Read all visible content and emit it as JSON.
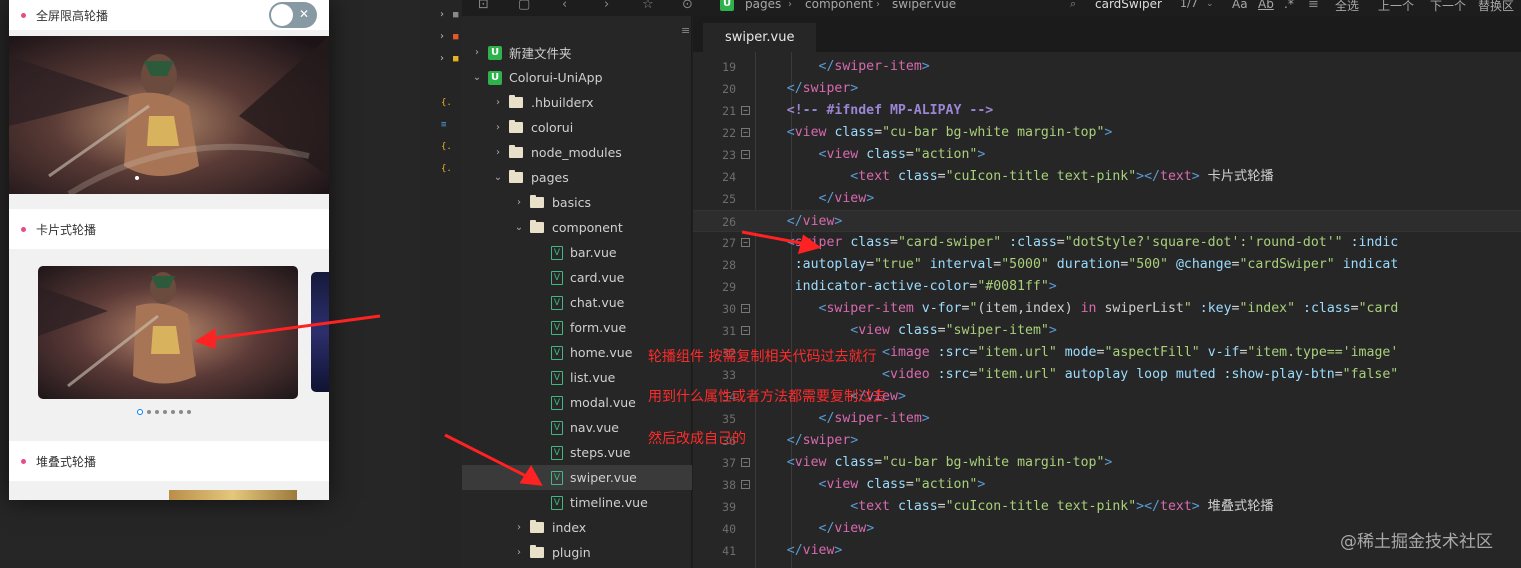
{
  "phone": {
    "section1_title": "全屏限高轮播",
    "section2_title": "卡片式轮播",
    "section3_title": "堆叠式轮播",
    "toggle_mark": "✕",
    "dots": [
      true,
      false,
      false,
      false,
      false,
      false,
      false
    ]
  },
  "toolbar": {
    "breadcrumb": [
      "pages",
      "component",
      "swiper.vue"
    ],
    "search_value": "cardSwiper",
    "match_count": "1/7",
    "select_all": "全选",
    "prev": "上一个",
    "next": "下一个",
    "replace": "替换区"
  },
  "explorer": {
    "items": [
      {
        "label": "新建文件夹",
        "type": "project",
        "level": 0,
        "chev": "›"
      },
      {
        "label": "Colorui-UniApp",
        "type": "project",
        "level": 0,
        "chev": "⌄"
      },
      {
        "label": ".hbuilderx",
        "type": "folder",
        "level": 1,
        "chev": "›"
      },
      {
        "label": "colorui",
        "type": "folder",
        "level": 1,
        "chev": "›"
      },
      {
        "label": "node_modules",
        "type": "folder",
        "level": 1,
        "chev": "›"
      },
      {
        "label": "pages",
        "type": "folder",
        "level": 1,
        "chev": "⌄"
      },
      {
        "label": "basics",
        "type": "folder",
        "level": 2,
        "chev": "›"
      },
      {
        "label": "component",
        "type": "folder",
        "level": 2,
        "chev": "⌄"
      },
      {
        "label": "bar.vue",
        "type": "vue",
        "level": 3,
        "chev": ""
      },
      {
        "label": "card.vue",
        "type": "vue",
        "level": 3,
        "chev": ""
      },
      {
        "label": "chat.vue",
        "type": "vue",
        "level": 3,
        "chev": ""
      },
      {
        "label": "form.vue",
        "type": "vue",
        "level": 3,
        "chev": ""
      },
      {
        "label": "home.vue",
        "type": "vue",
        "level": 3,
        "chev": ""
      },
      {
        "label": "list.vue",
        "type": "vue",
        "level": 3,
        "chev": ""
      },
      {
        "label": "modal.vue",
        "type": "vue",
        "level": 3,
        "chev": ""
      },
      {
        "label": "nav.vue",
        "type": "vue",
        "level": 3,
        "chev": ""
      },
      {
        "label": "steps.vue",
        "type": "vue",
        "level": 3,
        "chev": ""
      },
      {
        "label": "swiper.vue",
        "type": "vue",
        "level": 3,
        "chev": "",
        "selected": true
      },
      {
        "label": "timeline.vue",
        "type": "vue",
        "level": 3,
        "chev": ""
      },
      {
        "label": "index",
        "type": "folder",
        "level": 2,
        "chev": "›"
      },
      {
        "label": "plugin",
        "type": "folder",
        "level": 2,
        "chev": "›"
      }
    ]
  },
  "tab": {
    "label": "swiper.vue"
  },
  "editor": {
    "lines": [
      {
        "n": "19",
        "fold": false,
        "html": "        <span class='t'>&lt;/</span><span class='tg'>swiper-item</span><span class='t'>&gt;</span>"
      },
      {
        "n": "20",
        "fold": false,
        "html": "    <span class='t'>&lt;/</span><span class='tg'>swiper</span><span class='t'>&gt;</span>"
      },
      {
        "n": "21",
        "fold": true,
        "html": "    <span class='cm'>&lt;!-- #ifndef MP-ALIPAY --&gt;</span>"
      },
      {
        "n": "22",
        "fold": true,
        "html": "    <span class='t'>&lt;</span><span class='tg'>view</span> <span class='at'>class</span>=<span class='str'>\"cu-bar bg-white margin-top\"</span><span class='t'>&gt;</span>"
      },
      {
        "n": "23",
        "fold": true,
        "html": "        <span class='t'>&lt;</span><span class='tg'>view</span> <span class='at'>class</span>=<span class='str'>\"action\"</span><span class='t'>&gt;</span>"
      },
      {
        "n": "24",
        "fold": false,
        "html": "            <span class='t'>&lt;</span><span class='tg'>text</span> <span class='at'>class</span>=<span class='str'>\"cuIcon-title text-pink\"</span><span class='t'>&gt;&lt;/</span><span class='tg'>text</span><span class='t'>&gt;</span><span class='tx'> 卡片式轮播</span>"
      },
      {
        "n": "25",
        "fold": false,
        "html": "        <span class='t'>&lt;/</span><span class='tg'>view</span><span class='t'>&gt;</span>"
      },
      {
        "n": "26",
        "fold": false,
        "html": "    <span class='t'>&lt;/</span><span class='tg'>view</span><span class='t'>&gt;</span>"
      },
      {
        "n": "27",
        "fold": true,
        "html": "    <span class='t'>&lt;</span><span class='tg'>swiper</span> <span class='at'>class</span>=<span class='str'>\"card-swiper\"</span> <span class='at'>:class</span>=<span class='str'>\"dotStyle?'square-dot':'round-dot'\"</span> <span class='at'>:indic</span>"
      },
      {
        "n": "28",
        "fold": false,
        "html": "     <span class='at'>:autoplay</span>=<span class='str'>\"true\"</span> <span class='at'>interval</span>=<span class='str'>\"5000\"</span> <span class='at'>duration</span>=<span class='str'>\"500\"</span> <span class='at'>@change</span>=<span class='str'>\"cardSwiper\"</span> <span class='at'>indicat</span>"
      },
      {
        "n": "29",
        "fold": false,
        "html": "     <span class='at'>indicator-active-color</span>=<span class='str'>\"#0081ff\"</span><span class='t'>&gt;</span>"
      },
      {
        "n": "30",
        "fold": true,
        "html": "        <span class='t'>&lt;</span><span class='tg'>swiper-item</span> <span class='at'>v-for</span>=<span class='str'>\"</span><span class='tx'>(item,index) </span><span class='kw'>in</span><span class='tx'> swiperList</span><span class='str'>\"</span> <span class='at'>:key</span>=<span class='str'>\"index\"</span> <span class='at'>:class</span>=<span class='str'>\"card</span>"
      },
      {
        "n": "31",
        "fold": true,
        "html": "            <span class='t'>&lt;</span><span class='tg'>view</span> <span class='at'>class</span>=<span class='str'>\"swiper-item\"</span><span class='t'>&gt;</span>"
      },
      {
        "n": "32",
        "fold": false,
        "html": "                <span class='t'>&lt;</span><span class='tg'>image</span> <span class='at'>:src</span>=<span class='str'>\"item.url\"</span> <span class='at'>mode</span>=<span class='str'>\"aspectFill\"</span> <span class='at'>v-if</span>=<span class='str'>\"item.type=='image'</span>"
      },
      {
        "n": "33",
        "fold": false,
        "html": "                <span class='t'>&lt;</span><span class='tg'>video</span> <span class='at'>:src</span>=<span class='str'>\"item.url\"</span> <span class='at'>autoplay loop muted</span> <span class='at'>:show-play-btn</span>=<span class='str'>\"false\"</span>"
      },
      {
        "n": "34",
        "fold": false,
        "html": "            <span class='t'>&lt;/</span><span class='tg'>view</span><span class='t'>&gt;</span>"
      },
      {
        "n": "35",
        "fold": false,
        "html": "        <span class='t'>&lt;/</span><span class='tg'>swiper-item</span><span class='t'>&gt;</span>"
      },
      {
        "n": "36",
        "fold": false,
        "html": "    <span class='t'>&lt;/</span><span class='tg'>swiper</span><span class='t'>&gt;</span>"
      },
      {
        "n": "37",
        "fold": true,
        "html": "    <span class='t'>&lt;</span><span class='tg'>view</span> <span class='at'>class</span>=<span class='str'>\"cu-bar bg-white margin-top\"</span><span class='t'>&gt;</span>"
      },
      {
        "n": "38",
        "fold": true,
        "html": "        <span class='t'>&lt;</span><span class='tg'>view</span> <span class='at'>class</span>=<span class='str'>\"action\"</span><span class='t'>&gt;</span>"
      },
      {
        "n": "39",
        "fold": false,
        "html": "            <span class='t'>&lt;</span><span class='tg'>text</span> <span class='at'>class</span>=<span class='str'>\"cuIcon-title text-pink\"</span><span class='t'>&gt;&lt;/</span><span class='tg'>text</span><span class='t'>&gt;</span><span class='tx'> 堆叠式轮播</span>"
      },
      {
        "n": "40",
        "fold": false,
        "html": "        <span class='t'>&lt;/</span><span class='tg'>view</span><span class='t'>&gt;</span>"
      },
      {
        "n": "41",
        "fold": false,
        "html": "    <span class='t'>&lt;/</span><span class='tg'>view</span><span class='t'>&gt;</span>"
      }
    ]
  },
  "annotations": {
    "line1": "轮播组件  按需复制相关代码过去就行",
    "line2": "用到什么属性或者方法都需要复制过去",
    "line3": "然后改成自己的"
  },
  "watermark": "@稀土掘金技术社区",
  "colors": {
    "accent_pink": "#e54d8a",
    "active_dot": "#0081ff",
    "annotation_red": "#ff2b2b",
    "project_green": "#2fb24c"
  }
}
